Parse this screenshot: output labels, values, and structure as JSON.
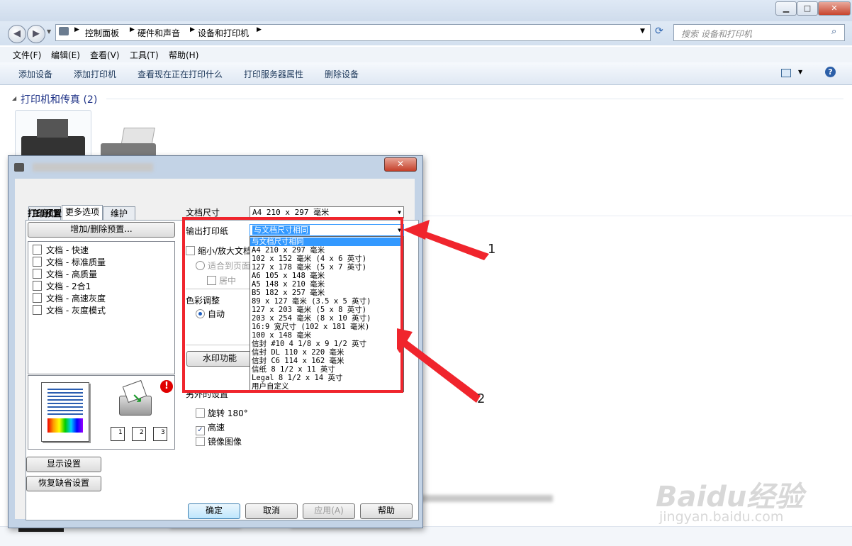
{
  "explorer": {
    "address_items": [
      "控制面板",
      "硬件和声音",
      "设备和打印机"
    ],
    "search_placeholder": "搜索 设备和打印机",
    "menu": [
      "文件(F)",
      "编辑(E)",
      "查看(V)",
      "工具(T)",
      "帮助(H)"
    ],
    "commands": [
      "添加设备",
      "添加打印机",
      "查看现在正在打印什么",
      "打印服务器属性",
      "删除设备"
    ],
    "group_header": "打印机和传真 (2)"
  },
  "dialog": {
    "tabs": [
      "主窗口",
      "更多选项",
      "维护"
    ],
    "active_tab": "更多选项",
    "presets_title": "打印预置",
    "add_remove_button": "增加/删除预置...",
    "presets": [
      "文档 - 快速",
      "文档 - 标准质量",
      "文档 - 高质量",
      "文档 - 2合1",
      "文档 - 高速灰度",
      "文档 - 灰度模式"
    ],
    "page_numbers": [
      "1",
      "2",
      "3"
    ],
    "alert_mark": "!",
    "show_settings_button": "显示设置",
    "restore_defaults_button": "恢复缺省设置",
    "doc_size_label": "文档尺寸",
    "doc_size_value": "A4 210 x 297 毫米",
    "output_paper_label": "输出打印纸",
    "output_paper_value": "与文档尺寸相同",
    "scale_label": "缩小/放大文档",
    "fit_page_label": "适合到页面",
    "center_label": "居中",
    "color_adjust_label": "色彩调整",
    "auto_label": "自动",
    "watermark_button": "水印功能",
    "extra_settings_label": "另外的设置",
    "rotate_label": "旋转 180°",
    "high_speed_label": "高速",
    "mirror_label": "镜像图像",
    "ok_button": "确定",
    "cancel_button": "取消",
    "apply_button": "应用(A)",
    "help_button": "帮助"
  },
  "dropdown_options": [
    "与文档尺寸相同",
    "A4 210 x 297 毫米",
    "102 x 152 毫米 (4 x 6 英寸)",
    "127 x 178 毫米 (5 x 7 英寸)",
    "A6 105 x 148 毫米",
    "A5 148 x 210 毫米",
    "B5 182 x 257 毫米",
    "89 x 127 毫米 (3.5 x 5 英寸)",
    "127 x 203 毫米 (5 x 8 英寸)",
    "203 x 254 毫米 (8 x 10 英寸)",
    "16:9 宽尺寸 (102 x 181 毫米)",
    "100 x 148 毫米",
    "信封 #10 4 1/8 x 9 1/2 英寸",
    "信封 DL  110 x 220 毫米",
    "信封 C6  114 x 162 毫米",
    "信纸 8 1/2 x 11 英寸",
    "Legal 8 1/2 x 14 英寸",
    "用户自定义"
  ],
  "selected_option_index": 0,
  "annotations": {
    "n1": "1",
    "n2": "2",
    "color": "#f0252d"
  },
  "watermark": {
    "brand": "Baidu经验",
    "url": "jingyan.baidu.com"
  }
}
